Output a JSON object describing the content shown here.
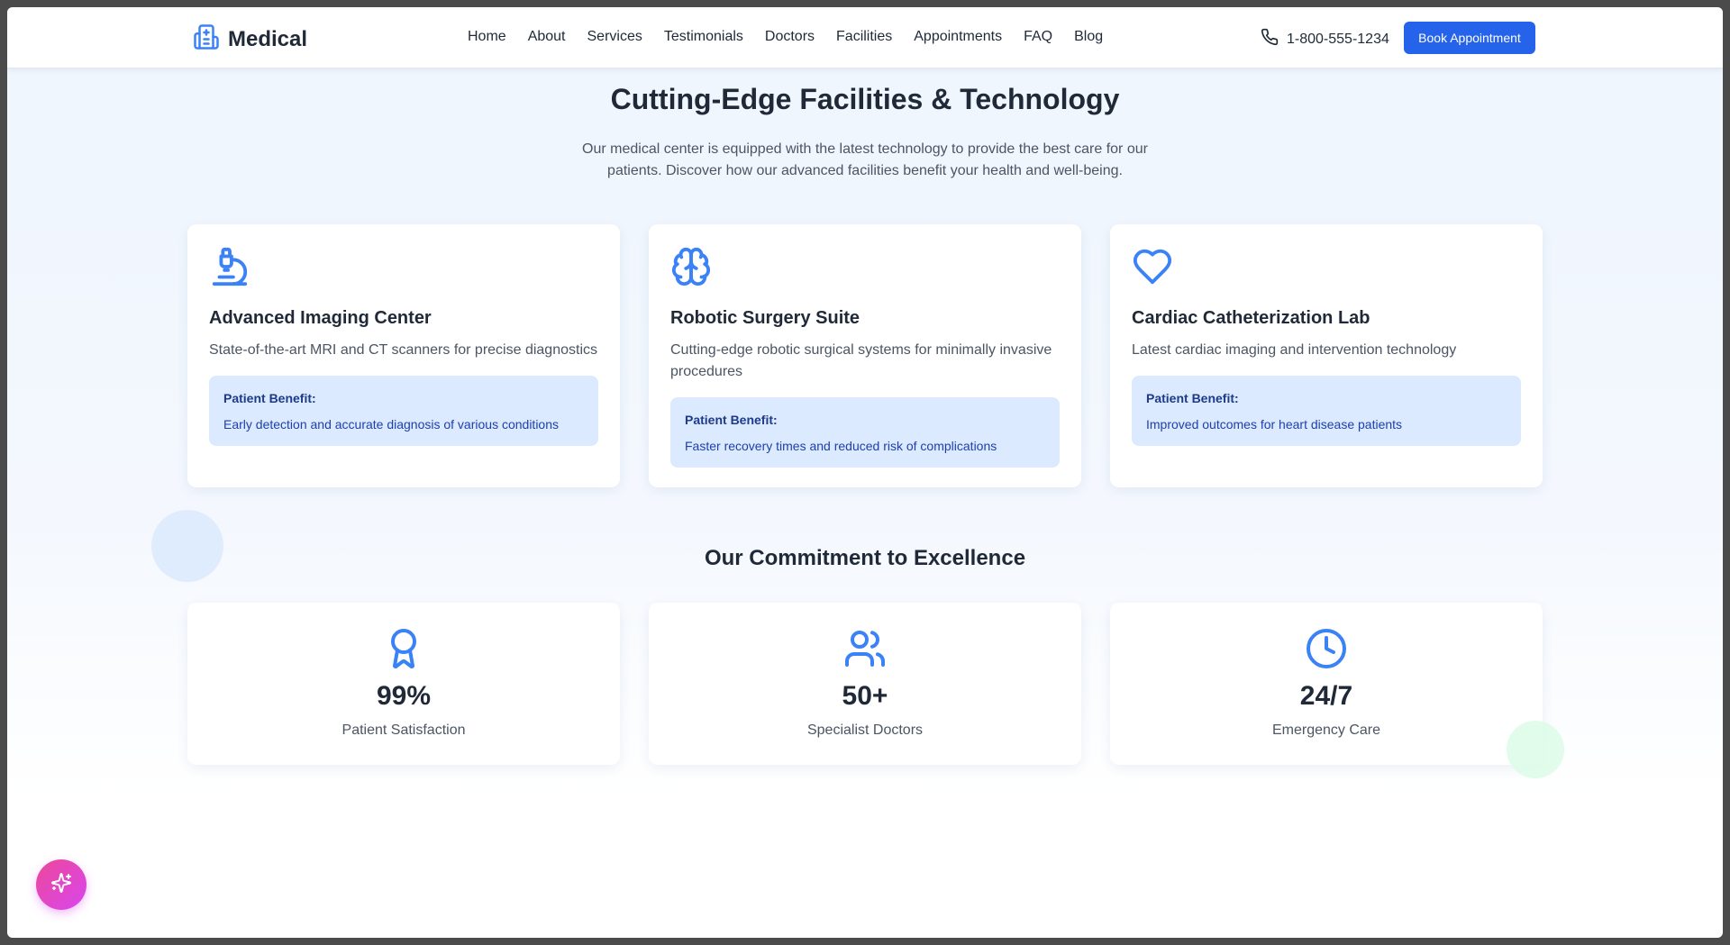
{
  "nav": {
    "brand": "Medical",
    "links": [
      "Home",
      "About",
      "Services",
      "Testimonials",
      "Doctors",
      "Facilities",
      "Appointments",
      "FAQ",
      "Blog"
    ],
    "phone": "1-800-555-1234",
    "cta": "Book Appointment"
  },
  "facilities": {
    "title": "Cutting-Edge Facilities & Technology",
    "subtitle": "Our medical center is equipped with the latest technology to provide the best care for our patients. Discover how our advanced facilities benefit your health and well-being.",
    "cards": [
      {
        "icon": "microscope-icon",
        "title": "Advanced Imaging Center",
        "description": "State-of-the-art MRI and CT scanners for precise diagnostics",
        "benefit_label": "Patient Benefit:",
        "benefit": "Early detection and accurate diagnosis of various conditions"
      },
      {
        "icon": "brain-icon",
        "title": "Robotic Surgery Suite",
        "description": "Cutting-edge robotic surgical systems for minimally invasive procedures",
        "benefit_label": "Patient Benefit:",
        "benefit": "Faster recovery times and reduced risk of complications"
      },
      {
        "icon": "heart-icon",
        "title": "Cardiac Catheterization Lab",
        "description": "Latest cardiac imaging and intervention technology",
        "benefit_label": "Patient Benefit:",
        "benefit": "Improved outcomes for heart disease patients"
      }
    ]
  },
  "commitment": {
    "title": "Our Commitment to Excellence",
    "stats": [
      {
        "icon": "award-icon",
        "value": "99%",
        "label": "Patient Satisfaction"
      },
      {
        "icon": "users-icon",
        "value": "50+",
        "label": "Specialist Doctors"
      },
      {
        "icon": "clock-icon",
        "value": "24/7",
        "label": "Emergency Care"
      }
    ]
  },
  "colors": {
    "accent": "#2563eb",
    "icon_blue": "#3b82f6",
    "benefit_bg": "#dbeafe",
    "fab_gradient_start": "#ec4899",
    "fab_gradient_end": "#d946ef"
  },
  "fab_icon": "sparkles-icon"
}
